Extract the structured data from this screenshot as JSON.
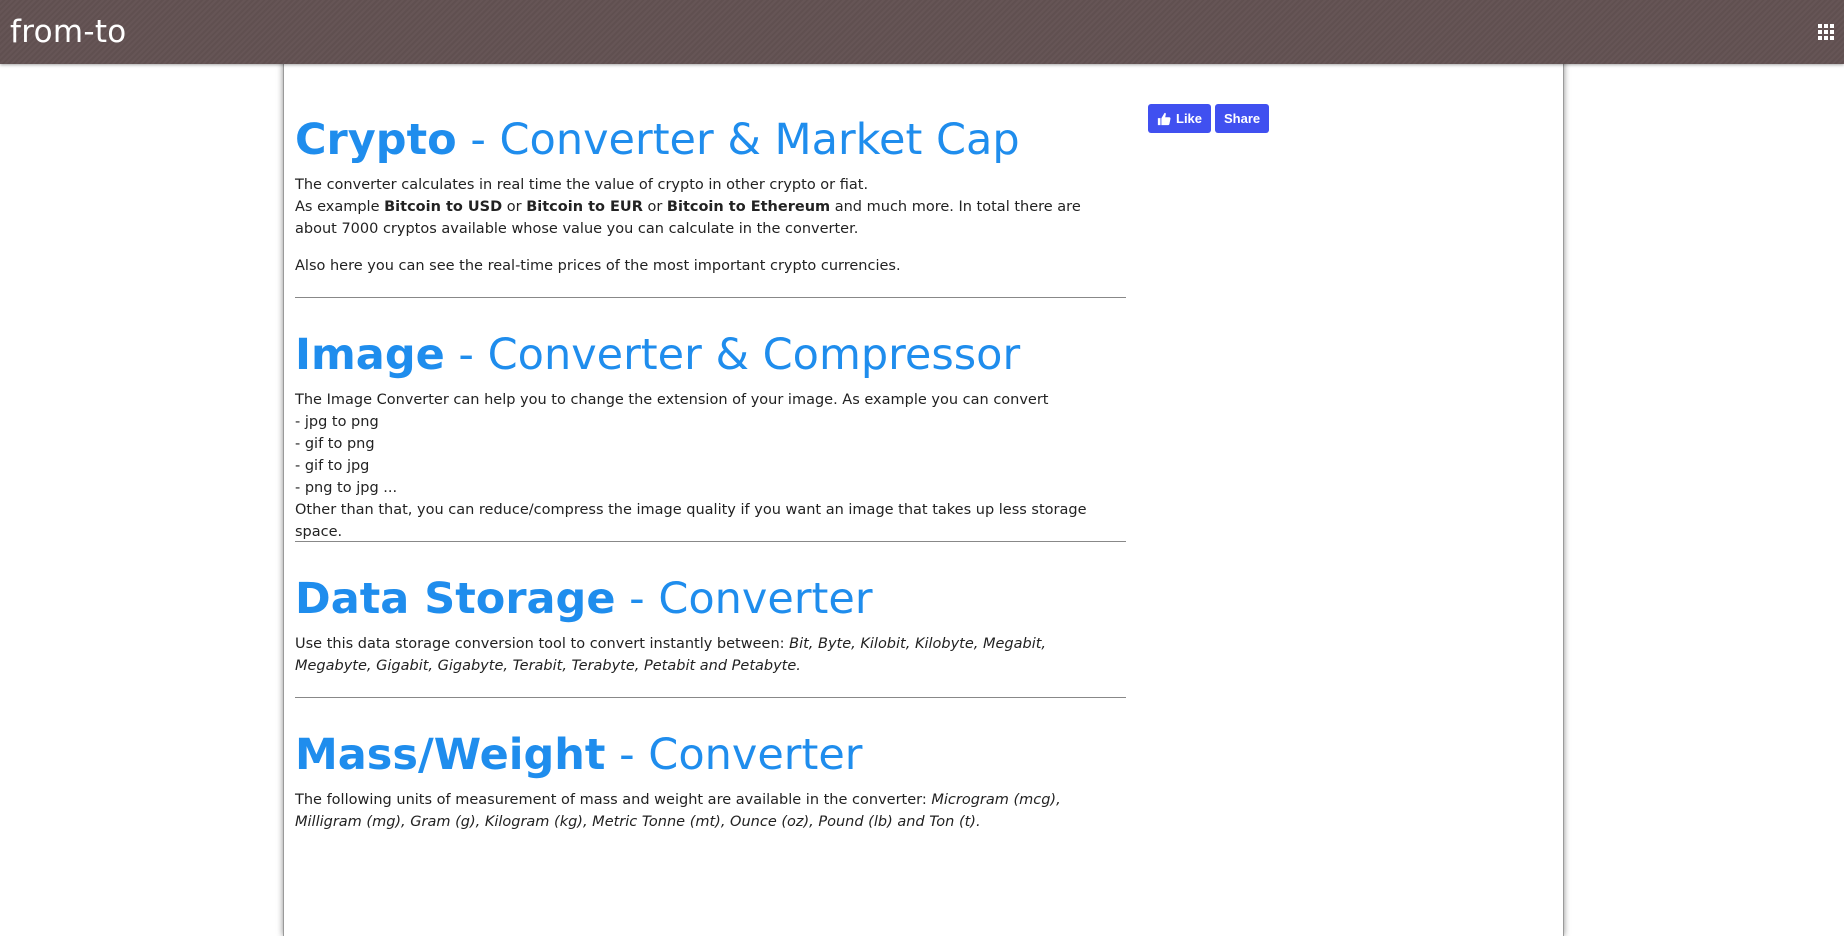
{
  "header": {
    "brand": "from-to",
    "menu_icon": "apps-grid-icon"
  },
  "social": {
    "like_label": "Like",
    "share_label": "Share",
    "color": "#4050f0"
  },
  "colors": {
    "topbar": "#625152",
    "heading": "#1f8ded"
  },
  "sections": [
    {
      "title_bold": "Crypto",
      "title_rest": " - Converter & Market Cap",
      "p1": "The converter calculates in real time the value of crypto in other crypto or fiat.",
      "p2_a": "As example ",
      "p2_b1": "Bitcoin to USD",
      "p2_or1": " or ",
      "p2_b2": "Bitcoin to EUR",
      "p2_or2": " or ",
      "p2_b3": "Bitcoin to Ethereum",
      "p2_c": " and much more. In total there are about 7000 cryptos available whose value you can calculate in the converter.",
      "p3": "Also here you can see the real-time prices of the most important crypto currencies."
    },
    {
      "title_bold": "Image",
      "title_rest": " - Converter & Compressor",
      "intro": "The Image Converter can help you to change the extension of your image. As example you can convert",
      "lines": [
        "- jpg to png",
        "- gif to png",
        "- gif to jpg",
        "- png to jpg ..."
      ],
      "outro": "Other than that, you can reduce/compress the image quality if you want an image that takes up less storage space."
    },
    {
      "title_bold": "Data Storage",
      "title_rest": " - Converter",
      "text": "Use this data storage conversion tool to convert instantly between: ",
      "units": "Bit, Byte, Kilobit, Kilobyte, Megabit, Megabyte, Gigabit, Gigabyte, Terabit, Terabyte, Petabit and Petabyte."
    },
    {
      "title_bold": "Mass/Weight",
      "title_rest": " - Converter",
      "text": "The following units of measurement of mass and weight are available in the converter: ",
      "units": "Microgram (mcg), Milligram (mg), Gram (g), Kilogram (kg), Metric Tonne (mt), Ounce (oz), Pound (lb) and Ton (t)."
    }
  ]
}
